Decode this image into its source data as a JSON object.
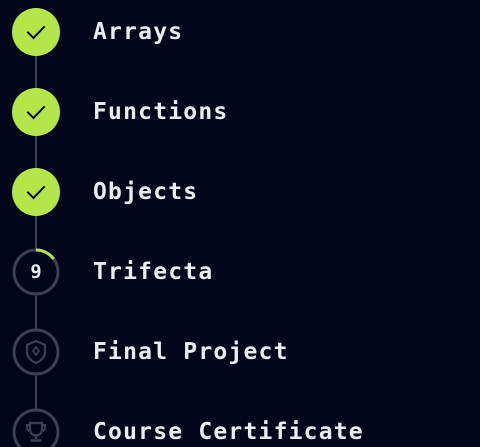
{
  "colors": {
    "background": "#03061a",
    "accent": "#b4e64a",
    "connector": "#3a4156",
    "text": "#e9ecf2",
    "locked_ring": "#3a4156"
  },
  "steps": [
    {
      "label": "Arrays",
      "status": "completed",
      "icon": "check-icon"
    },
    {
      "label": "Functions",
      "status": "completed",
      "icon": "check-icon"
    },
    {
      "label": "Objects",
      "status": "completed",
      "icon": "check-icon"
    },
    {
      "label": "Trifecta",
      "status": "in-progress",
      "count": "9",
      "progress": 0.15
    },
    {
      "label": "Final Project",
      "status": "locked",
      "icon": "badge-icon"
    },
    {
      "label": "Course Certificate",
      "status": "locked",
      "icon": "trophy-icon"
    }
  ]
}
